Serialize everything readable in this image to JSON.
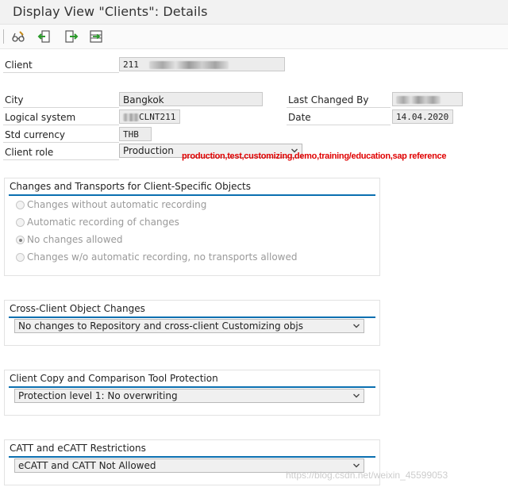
{
  "window": {
    "title": "Display View \"Clients\": Details"
  },
  "toolbar": {
    "buttons": [
      {
        "icon": "glasses-display-change-icon"
      },
      {
        "icon": "previous-entry-icon"
      },
      {
        "icon": "next-entry-icon"
      },
      {
        "icon": "variable-list-icon"
      }
    ]
  },
  "client": {
    "label": "Client",
    "number": "211"
  },
  "city": {
    "label": "City",
    "value": "Bangkok"
  },
  "last_changed_by": {
    "label": "Last Changed By"
  },
  "logical_system": {
    "label": "Logical system",
    "suffix": "CLNT211"
  },
  "date": {
    "label": "Date",
    "value": "14.04.2020"
  },
  "std_currency": {
    "label": "Std currency",
    "value": "THB"
  },
  "client_role": {
    "label": "Client role",
    "value": "Production"
  },
  "annotation": "production,test,customizing,demo,training/education,sap reference",
  "changes_group": {
    "title": "Changes and Transports for Client-Specific Objects",
    "options": [
      {
        "label": "Changes without automatic recording",
        "selected": false
      },
      {
        "label": "Automatic recording of changes",
        "selected": false
      },
      {
        "label": "No changes allowed",
        "selected": true
      },
      {
        "label": "Changes w/o automatic recording, no transports allowed",
        "selected": false
      }
    ]
  },
  "cross_client_group": {
    "title": "Cross-Client Object Changes",
    "value": "No changes to Repository and cross-client Customizing objs"
  },
  "copy_group": {
    "title": "Client Copy and Comparison Tool Protection",
    "value": "Protection level 1: No overwriting"
  },
  "catt_group": {
    "title": "CATT and eCATT Restrictions",
    "value": "eCATT and CATT Not Allowed"
  },
  "watermark": "https://blog.csdn.net/weixin_45599053"
}
